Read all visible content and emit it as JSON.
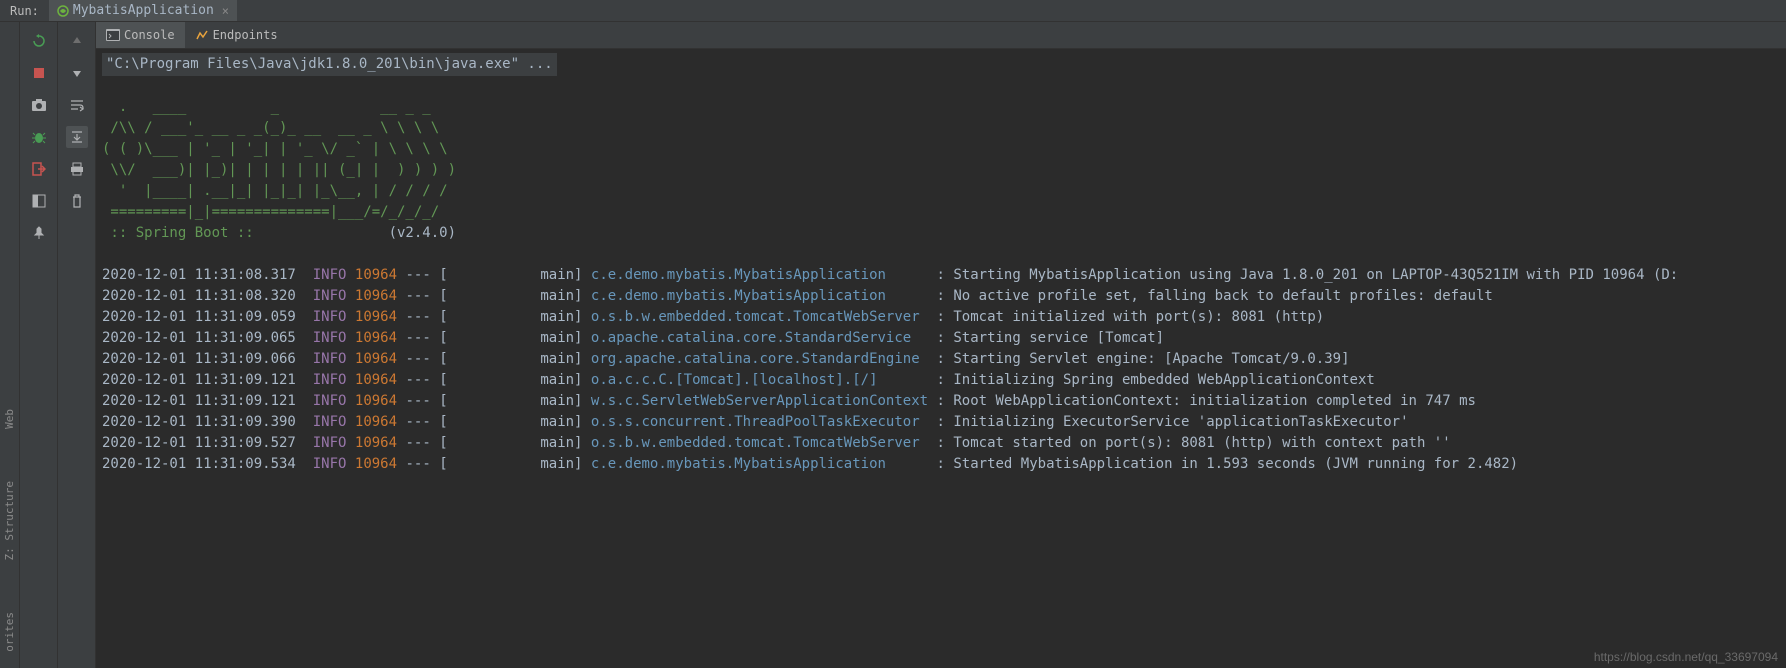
{
  "topbar": {
    "run_label": "Run:",
    "config_name": "MybatisApplication",
    "close": "×"
  },
  "tabs": {
    "console": "Console",
    "endpoints": "Endpoints"
  },
  "sidebar": {
    "web": "Web",
    "structure": "Z: Structure",
    "other": "orites"
  },
  "console": {
    "command": "\"C:\\Program Files\\Java\\jdk1.8.0_201\\bin\\java.exe\" ...",
    "ascii_line1": "  .   ____          _            __ _ _",
    "ascii_line2": " /\\\\ / ___'_ __ _ _(_)_ __  __ _ \\ \\ \\ \\",
    "ascii_line3": "( ( )\\___ | '_ | '_| | '_ \\/ _` | \\ \\ \\ \\",
    "ascii_line4": " \\\\/  ___)| |_)| | | | | || (_| |  ) ) ) )",
    "ascii_line5": "  '  |____| .__|_| |_|_| |_\\__, | / / / /",
    "ascii_line6": " =========|_|==============|___/=/_/_/_/",
    "spring_label": " :: Spring Boot ::",
    "spring_version": "                (v2.4.0)",
    "logs": [
      {
        "ts": "2020-12-01 11:31:08.317",
        "level": "INFO",
        "pid": "10964",
        "sep": " --- [",
        "thread": "           main] ",
        "logger": "c.e.demo.mybatis.MybatisApplication     ",
        "msg": " : Starting MybatisApplication using Java 1.8.0_201 on LAPTOP-43Q521IM with PID 10964 (D:"
      },
      {
        "ts": "2020-12-01 11:31:08.320",
        "level": "INFO",
        "pid": "10964",
        "sep": " --- [",
        "thread": "           main] ",
        "logger": "c.e.demo.mybatis.MybatisApplication     ",
        "msg": " : No active profile set, falling back to default profiles: default"
      },
      {
        "ts": "2020-12-01 11:31:09.059",
        "level": "INFO",
        "pid": "10964",
        "sep": " --- [",
        "thread": "           main] ",
        "logger": "o.s.b.w.embedded.tomcat.TomcatWebServer ",
        "msg": " : Tomcat initialized with port(s): 8081 (http)"
      },
      {
        "ts": "2020-12-01 11:31:09.065",
        "level": "INFO",
        "pid": "10964",
        "sep": " --- [",
        "thread": "           main] ",
        "logger": "o.apache.catalina.core.StandardService  ",
        "msg": " : Starting service [Tomcat]"
      },
      {
        "ts": "2020-12-01 11:31:09.066",
        "level": "INFO",
        "pid": "10964",
        "sep": " --- [",
        "thread": "           main] ",
        "logger": "org.apache.catalina.core.StandardEngine ",
        "msg": " : Starting Servlet engine: [Apache Tomcat/9.0.39]"
      },
      {
        "ts": "2020-12-01 11:31:09.121",
        "level": "INFO",
        "pid": "10964",
        "sep": " --- [",
        "thread": "           main] ",
        "logger": "o.a.c.c.C.[Tomcat].[localhost].[/]      ",
        "msg": " : Initializing Spring embedded WebApplicationContext"
      },
      {
        "ts": "2020-12-01 11:31:09.121",
        "level": "INFO",
        "pid": "10964",
        "sep": " --- [",
        "thread": "           main] ",
        "logger": "w.s.c.ServletWebServerApplicationContext",
        "msg": " : Root WebApplicationContext: initialization completed in 747 ms"
      },
      {
        "ts": "2020-12-01 11:31:09.390",
        "level": "INFO",
        "pid": "10964",
        "sep": " --- [",
        "thread": "           main] ",
        "logger": "o.s.s.concurrent.ThreadPoolTaskExecutor ",
        "msg": " : Initializing ExecutorService 'applicationTaskExecutor'"
      },
      {
        "ts": "2020-12-01 11:31:09.527",
        "level": "INFO",
        "pid": "10964",
        "sep": " --- [",
        "thread": "           main] ",
        "logger": "o.s.b.w.embedded.tomcat.TomcatWebServer ",
        "msg": " : Tomcat started on port(s): 8081 (http) with context path ''"
      },
      {
        "ts": "2020-12-01 11:31:09.534",
        "level": "INFO",
        "pid": "10964",
        "sep": " --- [",
        "thread": "           main] ",
        "logger": "c.e.demo.mybatis.MybatisApplication     ",
        "msg": " : Started MybatisApplication in 1.593 seconds (JVM running for 2.482)"
      }
    ]
  },
  "watermark": "https://blog.csdn.net/qq_33697094"
}
